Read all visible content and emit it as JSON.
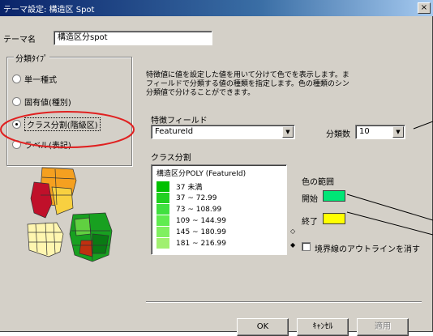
{
  "window": {
    "title": "テーマ設定: 構造区 Spot",
    "close_glyph": "×"
  },
  "theme_name": {
    "label": "テーマ名",
    "value": "構造区分spot"
  },
  "classification": {
    "group_title": "分類ﾀｲﾌﾟ",
    "options": [
      {
        "label": "単一種式",
        "checked": false
      },
      {
        "label": "固有値(種別)",
        "checked": false
      },
      {
        "label": "クラス分割(階級区)",
        "checked": true
      },
      {
        "label": "ラベル(表記)",
        "checked": false
      }
    ]
  },
  "description": {
    "lines": [
      "特徴値に値を設定した値を用いて分けて色でを表示します。ま",
      "フィールドで分類する値の種類を指定します。色の種類のシン",
      "分類値で分けることができます。"
    ]
  },
  "field": {
    "label": "特徴フィールド",
    "value": "FeatureId"
  },
  "divisions": {
    "label": "分類数",
    "value": "10"
  },
  "class_split": {
    "label": "クラス分割"
  },
  "class_list": {
    "header": "構造区分POLY (FeatureId)",
    "ranges": [
      {
        "label": "37 未満",
        "color": "#00c000"
      },
      {
        "label": "37 ~ 72.99",
        "color": "#20d020"
      },
      {
        "label": "73 ~ 108.99",
        "color": "#40e040"
      },
      {
        "label": "109 ~ 144.99",
        "color": "#60ec50"
      },
      {
        "label": "145 ~ 180.99",
        "color": "#80f060"
      },
      {
        "label": "181 ~ 216.99",
        "color": "#a0f070"
      }
    ]
  },
  "color_range": {
    "label": "色の範囲",
    "start_label": "開始",
    "start_color": "#00e676",
    "end_label": "終了",
    "end_color": "#ffff00"
  },
  "outline_checkbox": {
    "label": "境界線のアウトラインを消す",
    "checked": false
  },
  "buttons": {
    "ok": "OK",
    "cancel": "ｷｬﾝｾﾙ",
    "apply": "適用"
  },
  "icons": {
    "up_arrow": "up-arrow-icon",
    "down_arrow": "down-arrow-icon",
    "dropdown": "chevron-down-icon"
  },
  "colors": {
    "highlight_circle": "#e02020",
    "callout_line": "#000000"
  }
}
